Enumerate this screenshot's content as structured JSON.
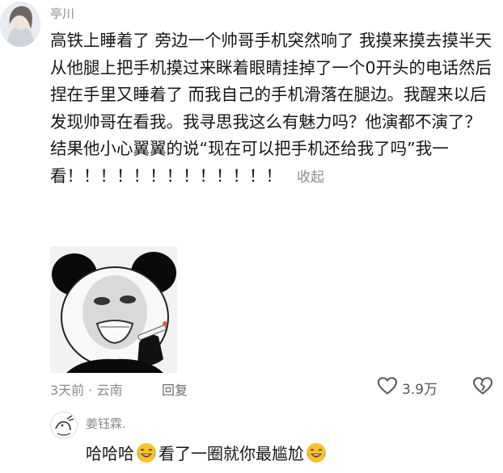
{
  "comment": {
    "username": "亭川",
    "text": "高铁上睡着了 旁边一个帅哥手机突然响了 我摸来摸去摸半天从他腿上把手机摸过来眯着眼睛挂掉了一个0开头的电话然后捏在手里又睡着了 而我自己的手机滑落在腿边。我醒来以后发现帅哥在看我。我寻思我这么有魅力吗？他演都不演了？结果他小心翼翼的说“现在可以把手机还给我了吗”我一看！！！！！！！！！！！！！",
    "collapse_label": "收起",
    "time_location": "3天前 · 云南",
    "reply_label": "回复",
    "like_count": "3.9万"
  },
  "reply": {
    "username": "姜钰霖.",
    "text_part1": "哈哈哈",
    "text_part2": "看了一圈就你最尴尬",
    "emoji_icon": "face-with-tears-of-joy-icon"
  },
  "colors": {
    "meta_gray": "#8a8a8a",
    "text_dark": "#161616",
    "emoji_yellow": "#f7c325"
  }
}
